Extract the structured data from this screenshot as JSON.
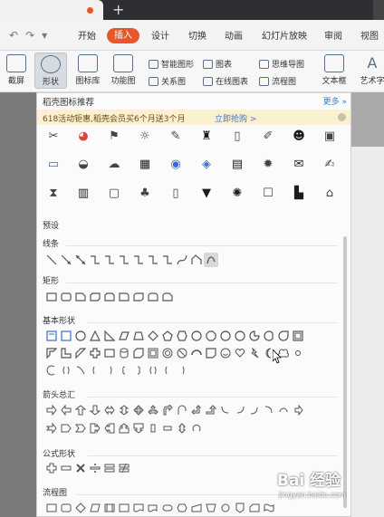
{
  "menu": {
    "items": [
      "开始",
      "插入",
      "设计",
      "切换",
      "动画",
      "幻灯片放映",
      "审阅",
      "视图"
    ],
    "active": "插入"
  },
  "ribbon": {
    "screenshot": "截屏",
    "shape": "形状",
    "iconlib": "图标库",
    "func": "功能图",
    "smart": "智能图形",
    "chart": "图表",
    "mind": "思维导图",
    "relation": "关系图",
    "online_chart": "在线图表",
    "flow": "流程图",
    "textbox": "文本框",
    "art": "艺术字"
  },
  "panel": {
    "title": "稻壳图标推荐",
    "more": "更多 »",
    "promo": "618活动钜惠,稻壳会员买6个月送3个月",
    "promo_link": "立即抢购 >",
    "preset": "预设",
    "sections": [
      "线条",
      "矩形",
      "基本形状",
      "箭头总汇",
      "公式形状",
      "流程图"
    ]
  },
  "watermark": {
    "brand": "Bai 经验",
    "url": "jingyan.baidu.com"
  },
  "icons": {
    "row1": [
      "tools-icon",
      "pie-chart-icon",
      "flag-icon",
      "bulb-icon",
      "pen-icon",
      "crown-icon",
      "document-icon",
      "note-icon",
      "users-icon",
      "camera-icon"
    ],
    "row2": [
      "wallet-icon",
      "bowl-icon",
      "cloud-icon",
      "building-icon",
      "target-icon",
      "cpu-icon",
      "contact-icon",
      "sun-icon",
      "envelope-icon",
      "edit-icon"
    ],
    "row3": [
      "hourglass-icon",
      "calendar-icon",
      "presentation-icon",
      "tree-icon",
      "file-icon",
      "basket-icon",
      "crab-icon",
      "robot-icon",
      "factory-icon",
      "home-icon"
    ]
  },
  "colors": {
    "accent": "#e8572c",
    "link": "#3a7bd5",
    "promo_bg": "#fbf0cf"
  }
}
